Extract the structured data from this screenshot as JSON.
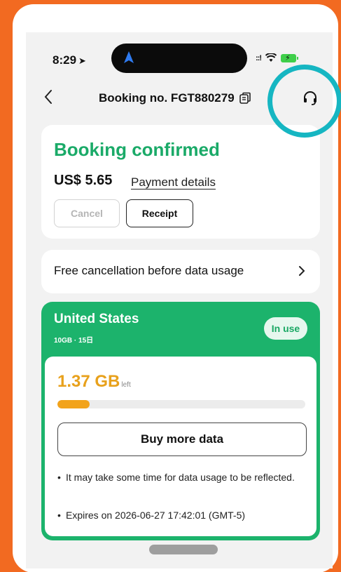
{
  "status_bar": {
    "time": "8:29",
    "signal": "::!"
  },
  "header": {
    "title": "Booking no. FGT880279"
  },
  "booking": {
    "status": "Booking confirmed",
    "price": "US$ 5.65",
    "payment_link": "Payment details",
    "cancel_label": "Cancel",
    "receipt_label": "Receipt"
  },
  "cancellation": {
    "text": "Free cancellation before data usage"
  },
  "plan": {
    "country": "United States",
    "details": "10GB · 15日",
    "badge": "In use",
    "remaining": "1.37 GB",
    "remaining_label": "left",
    "usage_fraction": 0.13,
    "buy_label": "Buy more data",
    "notes": [
      "It may take some time for data usage to be reflected.",
      "Expires on 2026-06-27 17:42:01 (GMT-5)"
    ]
  },
  "colors": {
    "accent_green": "#1cb36c",
    "highlight_ring": "#16b6c2",
    "data_amber": "#f2a31b",
    "background_orange": "#f26a21"
  },
  "icons": [
    "location-arrow-icon",
    "navigation-icon",
    "wifi-icon",
    "battery-icon",
    "back-icon",
    "copy-icon",
    "headset-icon",
    "chevron-right-icon"
  ]
}
